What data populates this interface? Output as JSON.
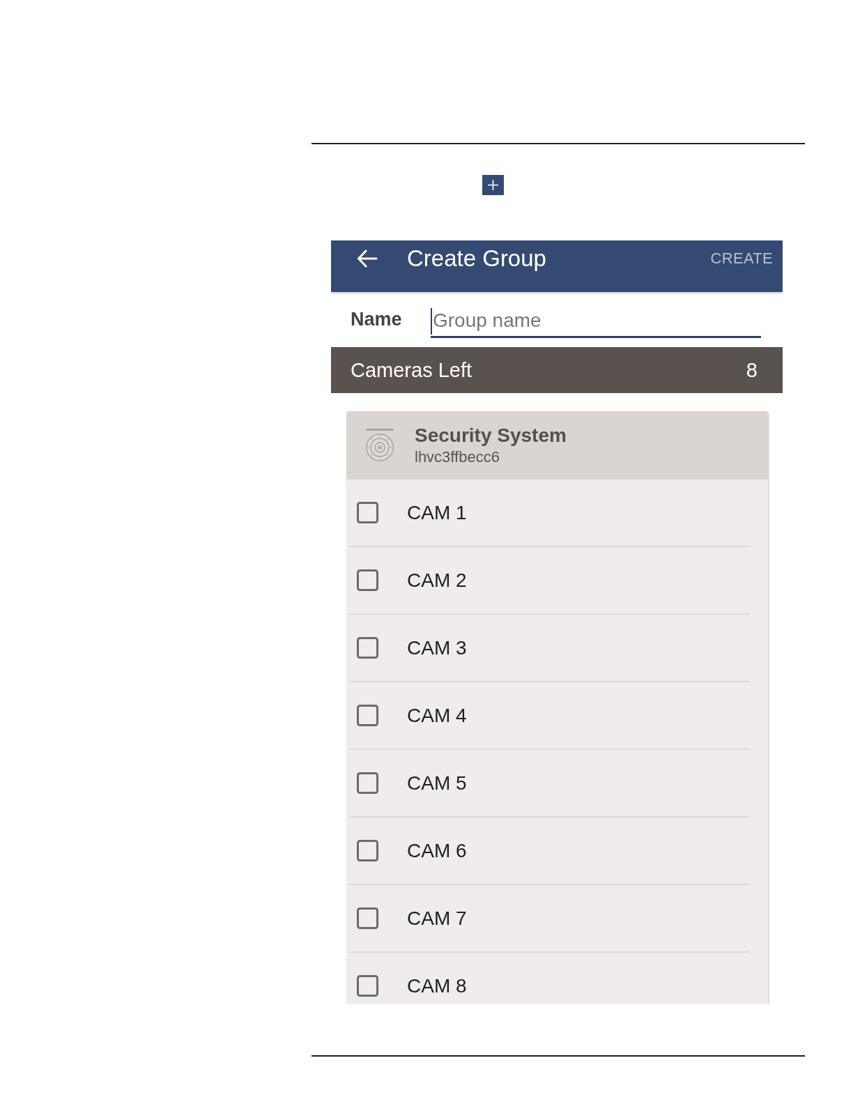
{
  "app_bar": {
    "title": "Create Group",
    "create_button": {
      "label": "CREATE",
      "disabled": true
    }
  },
  "name_field": {
    "label": "Name",
    "placeholder": "Group name",
    "focused": true
  },
  "cameras_left": {
    "label": "Cameras Left",
    "count": "8"
  },
  "device": {
    "name": "Security System",
    "id": "lhvc3ffbecc6"
  },
  "cameras": [
    {
      "name": "CAM 1",
      "checked": false
    },
    {
      "name": "CAM 2",
      "checked": false
    },
    {
      "name": "CAM 3",
      "checked": false
    },
    {
      "name": "CAM 4",
      "checked": false
    },
    {
      "name": "CAM 5",
      "checked": false
    },
    {
      "name": "CAM 6",
      "checked": false
    },
    {
      "name": "CAM 7",
      "checked": false
    },
    {
      "name": "CAM 8",
      "checked": false
    }
  ]
}
